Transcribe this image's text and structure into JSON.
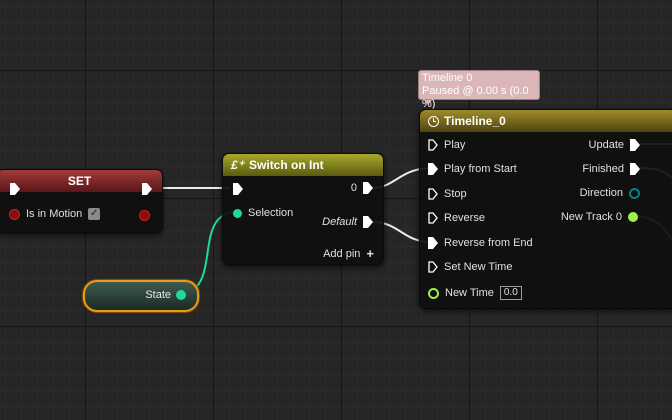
{
  "set_node": {
    "title": "SET",
    "var_label": "Is in Motion",
    "checked": true,
    "header_color": "#7e2626"
  },
  "switch_node": {
    "title": "Switch on Int",
    "icon": "function-icon",
    "out_0": "0",
    "selection": "Selection",
    "default": "Default",
    "add_pin": "Add pin",
    "header_color": "#8f8f18"
  },
  "state_node": {
    "label": "State"
  },
  "timeline_node": {
    "title": "Timeline_0",
    "icon": "clock-icon",
    "inputs": [
      "Play",
      "Play from Start",
      "Stop",
      "Reverse",
      "Reverse from End",
      "Set New Time",
      "New Time"
    ],
    "new_time_value": "0.0",
    "outputs": [
      "Update",
      "Finished",
      "Direction",
      "New Track 0"
    ],
    "header_color": "#7a6a1a"
  },
  "tooltip": {
    "line1": "Timeline 0",
    "line2": "Paused @ 0.00 s (0.0 %)"
  },
  "colors": {
    "exec": "#ffffff",
    "int_pin": "#1ed9a0",
    "bool_pin": "#8a0c0c",
    "float_pin": "#9cf24a",
    "enum_pin": "#0a6f6f",
    "selection_outline": "#e89d17"
  }
}
